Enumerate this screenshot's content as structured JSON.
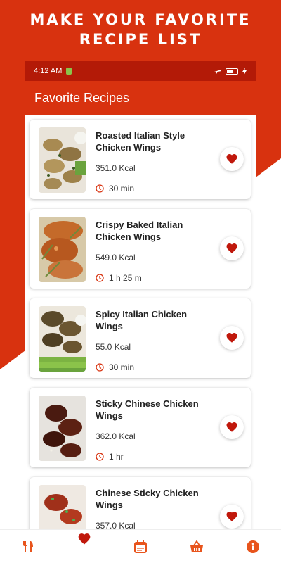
{
  "promo": {
    "line1": "MAKE YOUR FAVORITE",
    "line2": "RECIPE LIST"
  },
  "status_bar": {
    "time": "4:12 AM",
    "battery_label": "battery-charging"
  },
  "app_bar": {
    "title": "Favorite Recipes"
  },
  "recipes": [
    {
      "title": "Roasted Italian Style Chicken Wings",
      "kcal": "351.0 Kcal",
      "time": "30 min",
      "favorite": true
    },
    {
      "title": "Crispy Baked Italian Chicken Wings",
      "kcal": "549.0 Kcal",
      "time": "1 h 25 m",
      "favorite": true
    },
    {
      "title": "Spicy Italian Chicken Wings",
      "kcal": "55.0 Kcal",
      "time": "30 min",
      "favorite": true
    },
    {
      "title": "Sticky Chinese Chicken Wings",
      "kcal": "362.0 Kcal",
      "time": "1 hr",
      "favorite": true
    },
    {
      "title": "Chinese Sticky Chicken Wings",
      "kcal": "357.0 Kcal",
      "time": "",
      "favorite": true
    }
  ],
  "nav": {
    "items": [
      "fork-knife-icon",
      "heart-icon",
      "calendar-icon",
      "basket-icon",
      "info-icon"
    ],
    "active": "heart-icon"
  },
  "colors": {
    "brand": "#d8320f",
    "status_bar": "#b31a07",
    "heart": "#c0180c",
    "nav_icon": "#e8541c"
  }
}
